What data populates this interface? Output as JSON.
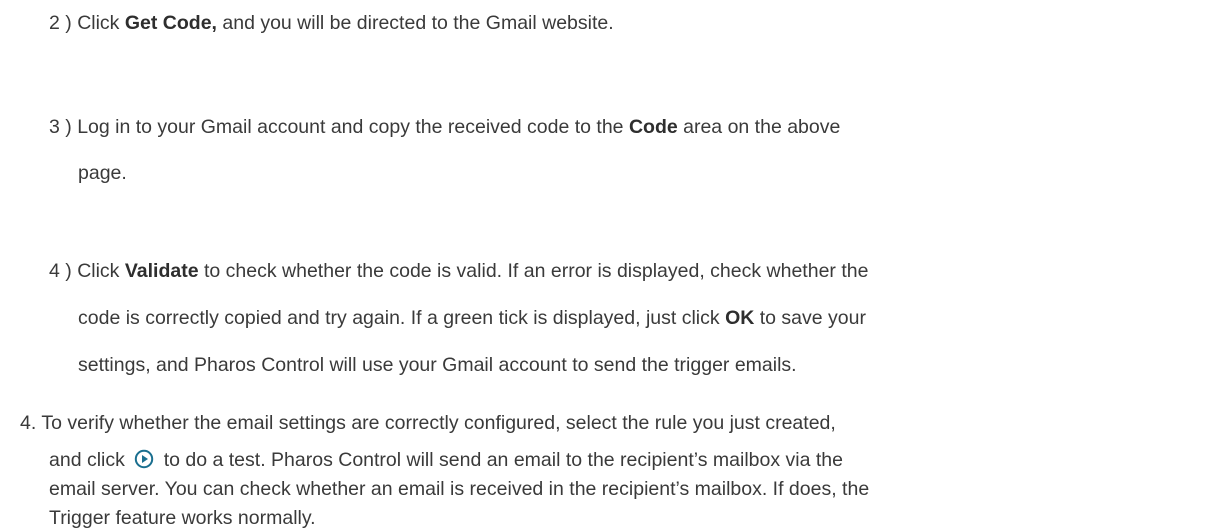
{
  "doc": {
    "step2": {
      "num": "2 )",
      "pre": "Click",
      "bold": "Get Code,",
      "post": "and you will be directed to the Gmail website."
    },
    "step3": {
      "num": "3 )",
      "line1_pre": "Log in to your Gmail account and copy the received code to the",
      "bold": "Code",
      "line1_post": "area on the above",
      "line2": "page."
    },
    "step4": {
      "num": "4 )",
      "line1_pre": "Click",
      "bold1": "Validate",
      "line1_post": "to check whether the code is valid. If an error is displayed, check whether the",
      "line2_pre": "code is correctly copied and try again. If a green tick is displayed, just click",
      "bold2": "OK",
      "line2_post": "to save your",
      "line3": "settings, and Pharos Control will use your Gmail account to send the trigger emails."
    },
    "item4": {
      "num": "4.",
      "line1": "To verify whether the email settings are correctly configured, select the rule you just created,",
      "line2_pre": "and click",
      "line2_post": "to do a test. Pharos Control will send an email to the recipient’s mailbox via the",
      "line3": "email server. You can check whether an email is received in the recipient’s mailbox. If does, the",
      "line4": "Trigger feature works normally."
    },
    "colors": {
      "text": "#3a3a3a",
      "icon": "#1a6f8f"
    }
  }
}
